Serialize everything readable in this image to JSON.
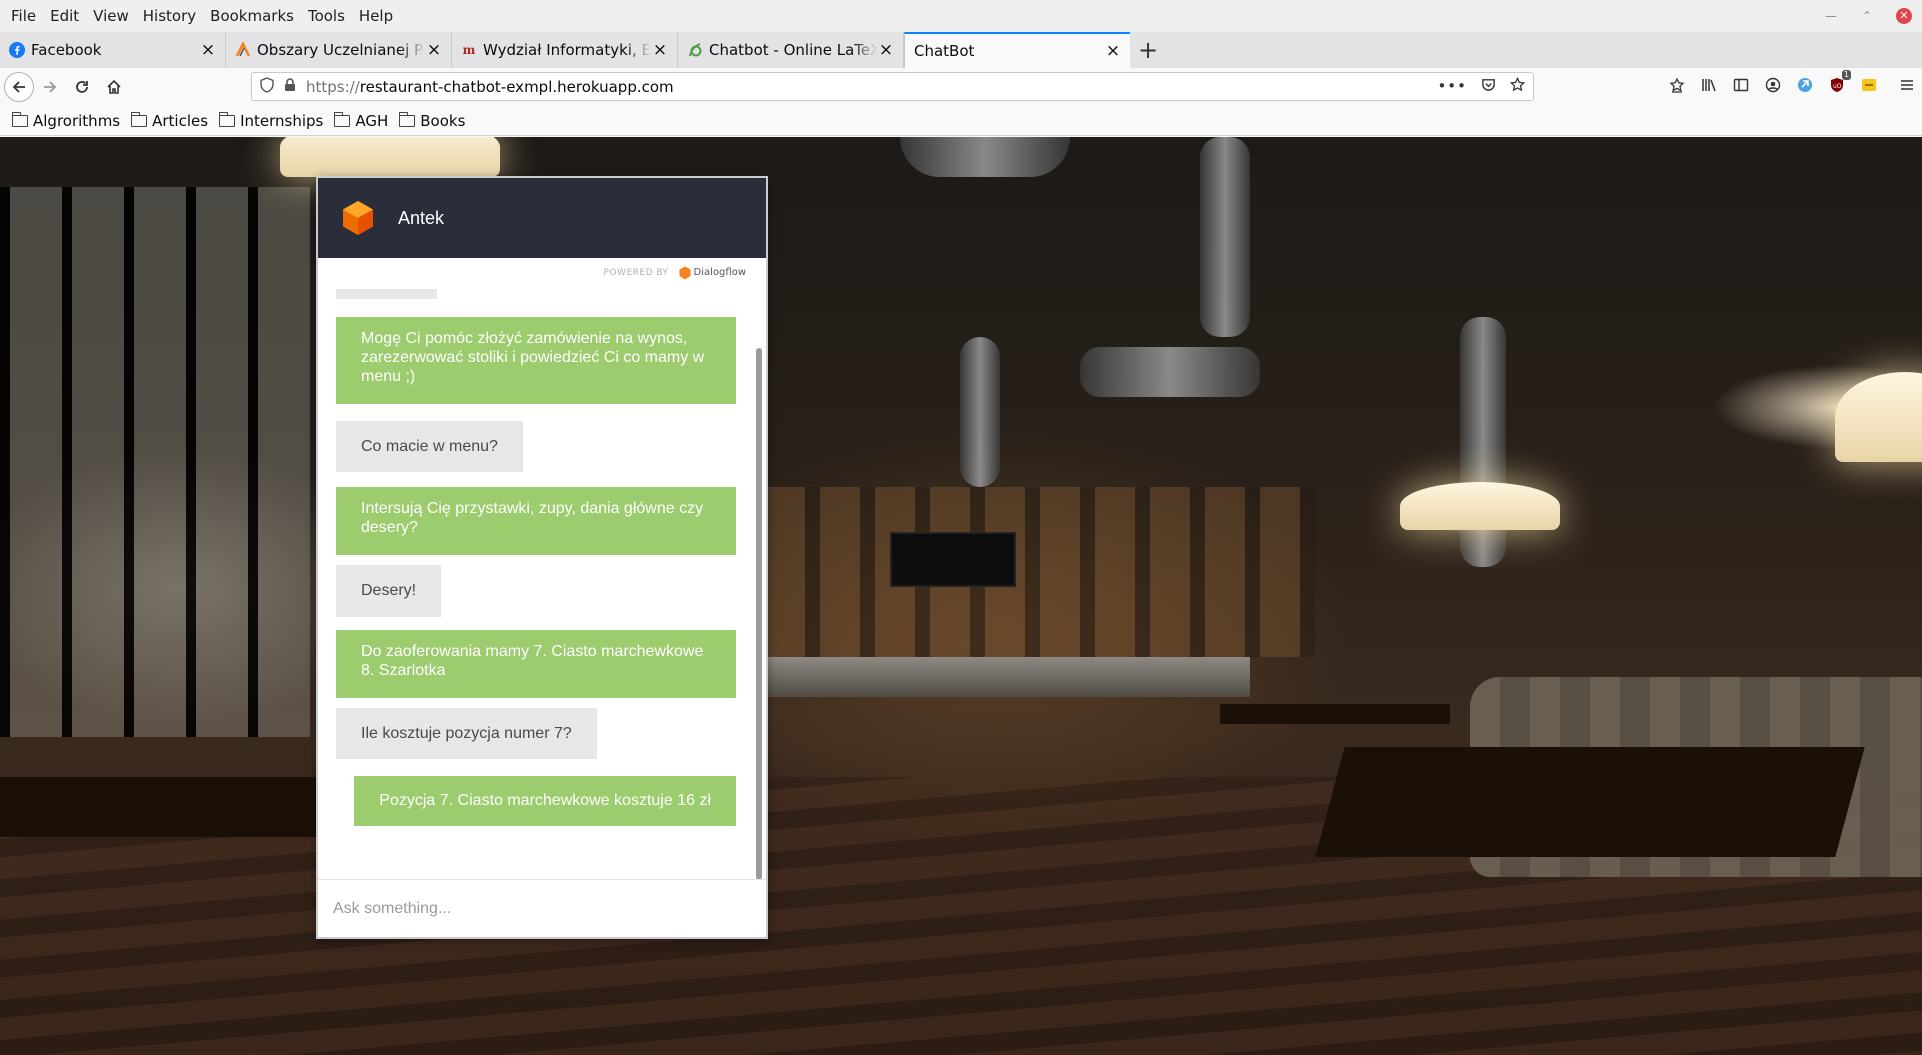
{
  "menubar": {
    "items": [
      {
        "label": "File"
      },
      {
        "label": "Edit"
      },
      {
        "label": "View"
      },
      {
        "label": "History"
      },
      {
        "label": "Bookmarks"
      },
      {
        "label": "Tools"
      },
      {
        "label": "Help"
      }
    ]
  },
  "tabs": [
    {
      "title": "Facebook",
      "icon": "facebook-icon",
      "active": false
    },
    {
      "title": "Obszary Uczelnianej Platformy",
      "icon": "upel-icon",
      "active": false
    },
    {
      "title": "Wydział Informatyki, Elektroniki",
      "icon": "agh-icon",
      "active": false
    },
    {
      "title": "Chatbot - Online LaTeX Editor",
      "icon": "overleaf-icon",
      "active": false
    },
    {
      "title": "ChatBot",
      "icon": "",
      "active": true
    }
  ],
  "navbar": {
    "url_prefix": "https://",
    "url_host": "restaurant-chatbot-exmpl.herokuapp.com",
    "addon_badge": "1"
  },
  "bookmarks": [
    {
      "label": "Algrorithms"
    },
    {
      "label": "Articles"
    },
    {
      "label": "Internships"
    },
    {
      "label": "AGH"
    },
    {
      "label": "Books"
    }
  ],
  "chat": {
    "agent_name": "Antek",
    "powered_by": "POWERED BY",
    "powered_brand": "Dialogflow",
    "input_placeholder": "Ask something...",
    "messages": [
      {
        "from": "user",
        "text": ""
      },
      {
        "from": "bot",
        "text": "Mogę Ci pomóc złożyć zamówienie na wynos, zarezerwować stoliki i powiedzieć Ci co mamy w menu ;)"
      },
      {
        "from": "user",
        "text": "Co macie w menu?"
      },
      {
        "from": "bot",
        "text": "Intersują Cię przystawki, zupy, dania główne czy desery?"
      },
      {
        "from": "user",
        "text": "Desery!"
      },
      {
        "from": "bot",
        "text": "Do zaoferowania mamy 7. Ciasto marchewkowe 8. Szarlotka"
      },
      {
        "from": "user",
        "text": "Ile kosztuje pozycja numer 7?"
      },
      {
        "from": "bot",
        "text": "Pozycja 7. Ciasto marchewkowe kosztuje 16 zł"
      }
    ]
  },
  "colors": {
    "chat_header": "#2a2e3b",
    "bot_bubble": "#9ccc6e",
    "user_bubble": "#e7e7e7",
    "tab_accent": "#0a84ff",
    "dialogflow_orange": "#f58220"
  }
}
